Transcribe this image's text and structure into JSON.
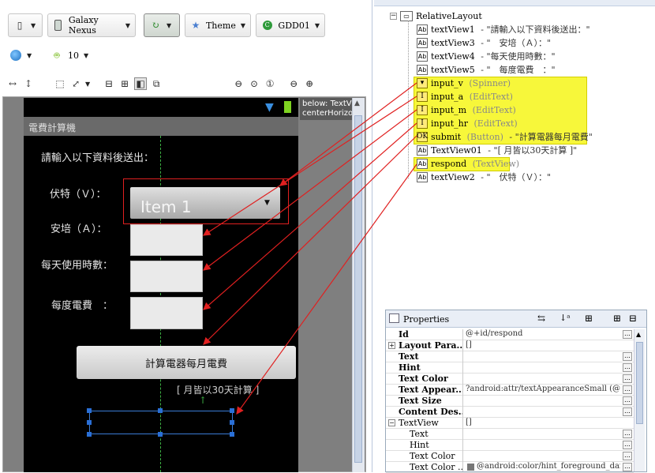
{
  "toolbar": {
    "device": "Galaxy Nexus",
    "theme": "Theme",
    "activity": "GDD01",
    "api": "10"
  },
  "app": {
    "title": "電費計算機",
    "hint": "below: TextView\ncenterHorizontal"
  },
  "layout": {
    "intro": "請輸入以下資料後送出：",
    "volt_label": "伏特（Ｖ）：",
    "amp_label": "安培（Ａ）：",
    "hours_label": "每天使用時數：",
    "degree_label": "每度電費　：",
    "spinner_value": "Item 1",
    "submit_label": "計算電器每月電費",
    "note": "[ 月皆以30天計算 ]"
  },
  "outline": {
    "root": "RelativeLayout",
    "items": [
      {
        "name": "textView1",
        "type": "",
        "desc": " - \"請輸入以下資料後送出：\"",
        "icon": "Ab",
        "hl": false
      },
      {
        "name": "textView3",
        "type": "",
        "desc": " - \"　安培（Ａ）：\"",
        "icon": "Ab",
        "hl": false
      },
      {
        "name": "textView4",
        "type": "",
        "desc": " - \"每天使用時數：\"",
        "icon": "Ab",
        "hl": false
      },
      {
        "name": "textView5",
        "type": "",
        "desc": " - \"　每度電費　：\"",
        "icon": "Ab",
        "hl": false
      },
      {
        "name": "input_v",
        "type": " (Spinner)",
        "desc": "",
        "icon": "▾",
        "hl": true
      },
      {
        "name": "input_a",
        "type": " (EditText)",
        "desc": "",
        "icon": "I",
        "hl": true
      },
      {
        "name": "input_m",
        "type": " (EditText)",
        "desc": "",
        "icon": "I",
        "hl": true
      },
      {
        "name": "input_hr",
        "type": " (EditText)",
        "desc": "",
        "icon": "I",
        "hl": true
      },
      {
        "name": "submit",
        "type": " (Button)",
        "desc": " - \"計算電器每月電費\"",
        "icon": "OK",
        "hl": true
      },
      {
        "name": "TextView01",
        "type": "",
        "desc": " - \"[ 月皆以30天計算 ]\"",
        "icon": "Ab",
        "hl": false
      },
      {
        "name": "respond",
        "type": " (TextView)",
        "desc": "",
        "icon": "Ab",
        "hl": true
      },
      {
        "name": "textView2",
        "type": "",
        "desc": " - \"　伏特（Ｖ）：\"",
        "icon": "Ab",
        "hl": false
      }
    ]
  },
  "properties": {
    "title": "Properties",
    "rows": [
      {
        "key": "Id",
        "value": "@+id/respond",
        "btn": true,
        "indent": 0
      },
      {
        "key": "Layout Para...",
        "value": "[]",
        "btn": false,
        "indent": 0,
        "expander": "+"
      },
      {
        "key": "Text",
        "value": "",
        "btn": true,
        "indent": 0
      },
      {
        "key": "Hint",
        "value": "",
        "btn": true,
        "indent": 0
      },
      {
        "key": "Text Color",
        "value": "",
        "btn": true,
        "indent": 0
      },
      {
        "key": "Text Appear...",
        "value": "?android:attr/textAppearanceSmall (@an...",
        "btn": true,
        "indent": 0
      },
      {
        "key": "Text Size",
        "value": "",
        "btn": true,
        "indent": 0
      },
      {
        "key": "Content Des...",
        "value": "",
        "btn": true,
        "indent": 0
      },
      {
        "key": "TextView",
        "value": "[]",
        "btn": false,
        "indent": 0,
        "expander": "−",
        "plain": true
      },
      {
        "key": "Text",
        "value": "",
        "btn": true,
        "indent": 1
      },
      {
        "key": "Hint",
        "value": "",
        "btn": true,
        "indent": 1
      },
      {
        "key": "Text Color",
        "value": "",
        "btn": true,
        "indent": 1
      },
      {
        "key": "Text Color ...",
        "value": "@android:color/hint_foreground_dark",
        "btn": true,
        "indent": 1,
        "swatch": true
      }
    ]
  },
  "colors": {
    "highlight": "#f7f73a",
    "arrow": "#e02020",
    "guide": "#3cb043",
    "selection": "#2a6fd6"
  }
}
